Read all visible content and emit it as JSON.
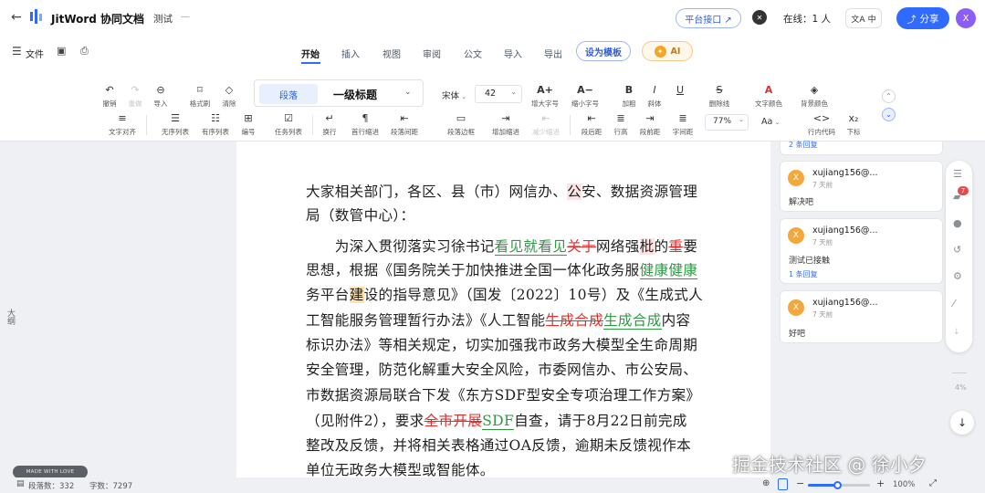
{
  "header": {
    "app_name": "JitWord 协同文档",
    "doc_title": "测试",
    "title_suffix": "—",
    "platform_link": "平台接口 ↗",
    "close_glyph": "✕",
    "online_label": "在线：1 人",
    "lang_label": "中",
    "share_label": "分享",
    "avatar_letter": "X"
  },
  "menu": {
    "file_label": "文件",
    "tabs": [
      "开始",
      "插入",
      "视图",
      "审阅",
      "公文",
      "导入",
      "导出"
    ],
    "active_tab": "开始",
    "template_btn": "设为模板",
    "ai_btn": "AI"
  },
  "toolbar": {
    "row1": [
      {
        "icon": "↶",
        "label": "撤销"
      },
      {
        "icon": "↷",
        "label": "重做"
      },
      {
        "icon": "⊖",
        "label": "导入"
      },
      {
        "icon": "⌑",
        "label": "格式刷"
      },
      {
        "icon": "◇",
        "label": "清除"
      }
    ],
    "style_preset": "段落",
    "style_heading": "一级标题",
    "font_family": "宋体",
    "font_size": "42",
    "row1b": [
      {
        "icon": "A+",
        "label": "增大字号"
      },
      {
        "icon": "A−",
        "label": "缩小字号"
      },
      {
        "icon": "B",
        "label": "加粗"
      },
      {
        "icon": "I",
        "label": "斜体"
      },
      {
        "icon": "U",
        "label": ""
      },
      {
        "icon": "S",
        "label": "删除线"
      },
      {
        "icon": "A",
        "label": "文字颜色"
      },
      {
        "icon": "◈",
        "label": "背景颜色"
      }
    ],
    "row2": [
      {
        "icon": "≡",
        "label": "文字对齐"
      },
      {
        "icon": "☰",
        "label": "无序列表"
      },
      {
        "icon": "☷",
        "label": "有序列表"
      },
      {
        "icon": "⊞",
        "label": "编号"
      },
      {
        "icon": "☑",
        "label": "任务列表"
      },
      {
        "icon": "↵",
        "label": "换行"
      },
      {
        "icon": "¶",
        "label": "首行缩进"
      },
      {
        "icon": "⇤",
        "label": "段落间距"
      },
      {
        "icon": "▭",
        "label": "段落边框"
      },
      {
        "icon": "⇥",
        "label": "增加缩进"
      },
      {
        "icon": "⇤",
        "label": "减少缩进"
      },
      {
        "icon": "⇤",
        "label": "段后距"
      },
      {
        "icon": "≣",
        "label": "行高"
      },
      {
        "icon": "⇥",
        "label": "段前距"
      },
      {
        "icon": "≣",
        "label": "字间距"
      },
      {
        "icon": "Aa",
        "label": ""
      },
      {
        "icon": "<>",
        "label": "行内代码"
      },
      {
        "icon": "x₂",
        "label": "下标"
      }
    ],
    "zoom_value": "77%"
  },
  "outline_label": "大纲",
  "document": {
    "lines": [
      [
        {
          "t": "大家相关部门，各区、县（市）网信办、"
        },
        {
          "t": "公",
          "c": "hlr"
        },
        {
          "t": "安、数据资源管理"
        }
      ],
      [
        {
          "t": "局（数管中心）："
        }
      ],
      [
        {
          "t": "　　为深入贯彻落实习徐书记"
        },
        {
          "t": "看见就看见",
          "c": "ins"
        },
        {
          "t": "关于",
          "c": "del"
        },
        {
          "t": "网络强"
        },
        {
          "t": "枇",
          "c": "hlr"
        },
        {
          "t": "的"
        },
        {
          "t": "重",
          "c": "del"
        },
        {
          "t": "要"
        }
      ],
      [
        {
          "t": "思想，根据《国务院关于加快推进全国一体化政务服"
        },
        {
          "t": "健康健康",
          "c": "ins"
        }
      ],
      [
        {
          "t": "务平台"
        },
        {
          "t": "建",
          "c": "hl"
        },
        {
          "t": "设的指导意见》（国发〔2022〕10号）及《生成式人"
        }
      ],
      [
        {
          "t": "工智能服务管理暂行办法》《人工智能"
        },
        {
          "t": "生成合成",
          "c": "del"
        },
        {
          "t": "生成合成",
          "c": "ins"
        },
        {
          "t": "内容"
        }
      ],
      [
        {
          "t": "标识办法》等相关规定，切实加强我市政务大模型全生命周期"
        }
      ],
      [
        {
          "t": "安全管理，防范化解重大安全风险，市委网信办、市公安局、"
        }
      ],
      [
        {
          "t": "市数据资源局联合下发《东方SDF型安全专项治理工作方案》"
        }
      ],
      [
        {
          "t": "（见附件2），要求"
        },
        {
          "t": "全市开展",
          "c": "del"
        },
        {
          "t": "SDF",
          "c": "ins"
        },
        {
          "t": "自查，请于8月22日前完成"
        }
      ],
      [
        {
          "t": "整改及反馈，并将相关表格通过OA反馈，逾期未反馈视作本"
        }
      ],
      [
        {
          "t": "单位无政务大模型或智能体。"
        }
      ]
    ]
  },
  "comments": {
    "top_fragment": "2 条回复",
    "items": [
      {
        "user": "xujiang156@...",
        "time": "7 天前",
        "text": "解决吧",
        "reply": ""
      },
      {
        "user": "xujiang156@...",
        "time": "7 天前",
        "text": "测试已接触",
        "reply": "1 条回复"
      },
      {
        "user": "xujiang156@...",
        "time": "7 天前",
        "text": "好吧",
        "reply": ""
      }
    ]
  },
  "rail": {
    "badge": "7",
    "zoom_text": "4%"
  },
  "status": {
    "paragraphs": "段落数：332",
    "words": "字数：7297",
    "zoom": "100%"
  },
  "watermark": "掘金技术社区 @ 徐小夕",
  "small_badge": "MADE WITH LOVE"
}
